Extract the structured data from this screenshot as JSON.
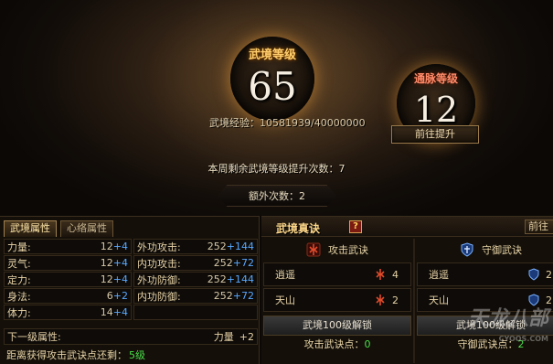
{
  "hero": {
    "wujing_level": {
      "label": "武境等级",
      "value": "65"
    },
    "tongmai_level": {
      "label": "通脉等级",
      "value": "12"
    },
    "experience": {
      "label": "武境经验：",
      "value": "10581939/40000000"
    },
    "goto_button": "前往提升",
    "weekly_remaining": "本周剩余武境等级提升次数：7",
    "extra_times": "额外次数：2"
  },
  "left_panel": {
    "tabs": [
      "武境属性",
      "心络属性"
    ],
    "attributes": [
      {
        "left": {
          "name": "力量:",
          "base": "12",
          "bonus": "+4"
        },
        "right": {
          "name": "外功攻击:",
          "base": "252",
          "bonus": "+144"
        }
      },
      {
        "left": {
          "name": "灵气:",
          "base": "12",
          "bonus": "+4"
        },
        "right": {
          "name": "内功攻击:",
          "base": "252",
          "bonus": "+72"
        }
      },
      {
        "left": {
          "name": "定力:",
          "base": "12",
          "bonus": "+4"
        },
        "right": {
          "name": "外功防御:",
          "base": "252",
          "bonus": "+144"
        }
      },
      {
        "left": {
          "name": "身法:",
          "base": "6",
          "bonus": "+2"
        },
        "right": {
          "name": "内功防御:",
          "base": "252",
          "bonus": "+72"
        }
      },
      {
        "left": {
          "name": "体力:",
          "base": "14",
          "bonus": "+4"
        }
      }
    ],
    "next_level": {
      "label": "下一级属性:",
      "attr": "力量",
      "value": "+2"
    },
    "distance": {
      "label": "距离获得攻击武诀点还剩：",
      "value": "5级"
    }
  },
  "right_panel": {
    "title": "武境真诀",
    "help": "?",
    "edge_button": "前往",
    "attack": {
      "title": "攻击武诀",
      "skills": [
        {
          "name": "逍遥",
          "count": "4"
        },
        {
          "name": "天山",
          "count": "2"
        }
      ],
      "unlock": "武境100级解锁",
      "points_label": "攻击武诀点：",
      "points_value": "0"
    },
    "defense": {
      "title": "守御武诀",
      "skills": [
        {
          "name": "逍遥",
          "count": "2"
        },
        {
          "name": "天山",
          "count": "2"
        }
      ],
      "unlock": "武境100级解锁",
      "points_label": "守御武诀点：",
      "points_value": "2"
    }
  },
  "watermark": {
    "main": "天龙八部",
    "sub": "CYOOS.COM"
  },
  "colors": {
    "gold": "#ffcf6e",
    "bonus_blue": "#58a8ff",
    "green": "#4ade4a"
  }
}
